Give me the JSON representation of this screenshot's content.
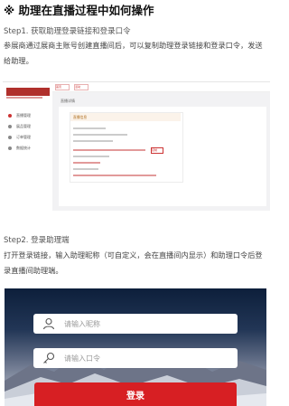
{
  "title": "※ 助理在直播过程中如何操作",
  "step1": {
    "heading": "Step1. 获取助理登录链接和登录口令",
    "desc": "参展商通过展商主账号创建直播间后，可以复制助理登录链接和登录口令，发送给助理。",
    "screenshot": {
      "tabs": [
        "首页",
        "活动"
      ],
      "nav_items": [
        "直播管理",
        "展品管理",
        "订单管理",
        "数据统计"
      ],
      "breadcrumb": "直播详情",
      "card_heading": "直播信息",
      "copy_button": "复制"
    }
  },
  "step2": {
    "heading": "Step2. 登录助理端",
    "desc": "打开登录链接，输入助理昵称（可自定义，会在直播间内显示）和助理口令后登录直播间助理端。",
    "nickname_placeholder": "请输入昵称",
    "code_placeholder": "请输入口令",
    "login_label": "登录"
  },
  "colors": {
    "accent": "#d71f23",
    "brand": "#b0302c"
  },
  "icons": {
    "nickname": "user-icon",
    "code": "key-icon"
  }
}
